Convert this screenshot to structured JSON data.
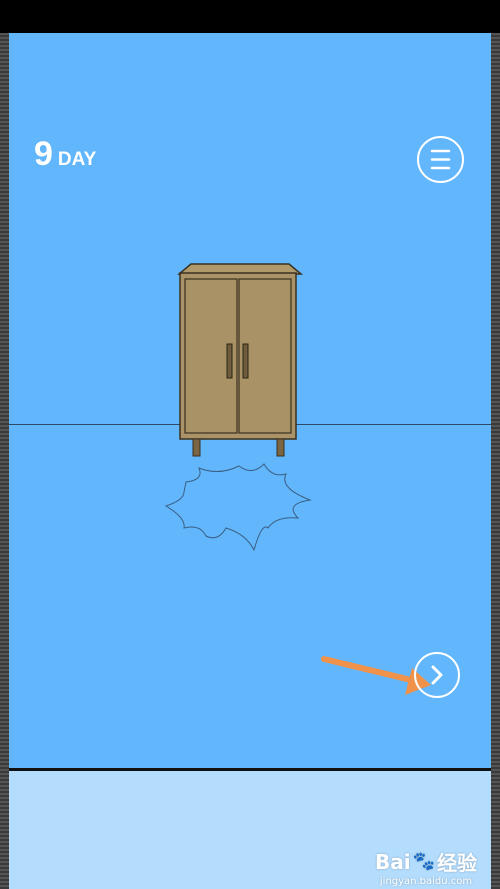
{
  "hud": {
    "day_number": "9",
    "day_label": "DAY"
  },
  "icons": {
    "menu": "hamburger-menu-icon",
    "next": "chevron-right-icon",
    "arrow": "orange-pointer-arrow"
  },
  "colors": {
    "room_background": "#62b6fb",
    "lower_panel": "#b3dcfd",
    "cabinet": "#aa9467",
    "arrow": "#f0924a"
  },
  "watermark": {
    "main_prefix": "Bai",
    "main_suffix": "经验",
    "sub": "jingyan.baidu.com"
  }
}
